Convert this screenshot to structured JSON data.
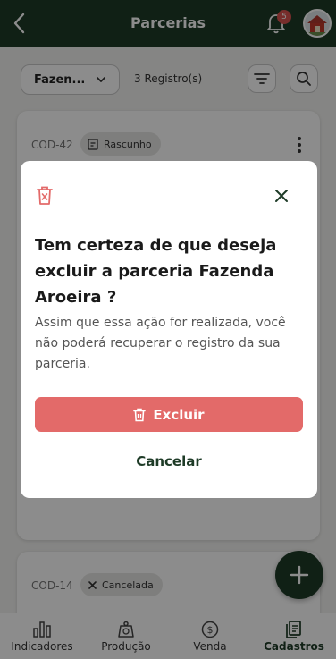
{
  "header": {
    "title": "Parcerias",
    "back_icon": "chevron-left-icon",
    "notifications_count": "5"
  },
  "toolbar": {
    "filter_value": "Fazen...",
    "count": "3 Registro(s)"
  },
  "cards": [
    {
      "code": "COD-42",
      "status": "Rascunho"
    },
    {
      "code": "COD-14",
      "status": "Cancelada"
    }
  ],
  "tabs": [
    {
      "label": "Indicadores",
      "icon": "bar-chart-icon"
    },
    {
      "label": "Produção",
      "icon": "scale-icon"
    },
    {
      "label": "Venda",
      "icon": "dollar-circle-icon"
    },
    {
      "label": "Cadastros",
      "icon": "documents-icon",
      "active": true
    }
  ],
  "modal": {
    "title": "Tem certeza de que deseja excluir a parceria Fazenda Aroeira ?",
    "text": "Assim que essa ação for realizada, você não poderá recuperar o registro da sua parceria.",
    "delete_label": "Excluir",
    "cancel_label": "Cancelar"
  },
  "colors": {
    "primary": "#1e3b27",
    "danger": "#e36a69",
    "badge": "#d9534f"
  }
}
